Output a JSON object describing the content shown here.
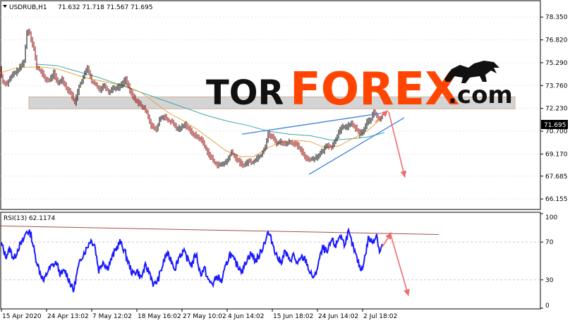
{
  "header": {
    "symbol": "USDRUB,H1",
    "ohlc": "71.632 71.718 71.567 71.695"
  },
  "logo": {
    "part1": "TOR",
    "part2": "FOREX",
    "part3": ".com"
  },
  "colors": {
    "price": "#000000",
    "bull": "#000000",
    "bear": "#8b0000",
    "ma_fast": "#e8a33a",
    "ma_slow": "#3aa8a8",
    "trendline": "#3d7fe0",
    "arrow": "#f06a6a",
    "zone": "#d0d0d0",
    "rsi": "#1a1aff",
    "rsi_resistance": "#a05050",
    "logo_dark": "#111111",
    "logo_orange": "#ff4500"
  },
  "chart_data": [
    {
      "type": "line",
      "title": "USDRUB,H1",
      "ylim": [
        65.5,
        79.4
      ],
      "yticks": [
        "78.350",
        "76.820",
        "75.290",
        "73.760",
        "72.230",
        "70.700",
        "69.170",
        "67.685",
        "66.155"
      ],
      "current_price": "71.695",
      "price_path": [
        [
          0,
          74.9
        ],
        [
          4,
          74.0
        ],
        [
          10,
          73.9
        ],
        [
          18,
          74.5
        ],
        [
          26,
          74.8
        ],
        [
          34,
          75.4
        ],
        [
          38,
          77.3
        ],
        [
          41,
          77.5
        ],
        [
          44,
          76.9
        ],
        [
          48,
          76.2
        ],
        [
          52,
          75.0
        ],
        [
          58,
          74.7
        ],
        [
          64,
          74.2
        ],
        [
          70,
          74.1
        ],
        [
          76,
          74.6
        ],
        [
          82,
          73.9
        ],
        [
          88,
          74.2
        ],
        [
          94,
          73.6
        ],
        [
          100,
          73.3
        ],
        [
          106,
          72.6
        ],
        [
          112,
          73.7
        ],
        [
          118,
          74.3
        ],
        [
          124,
          75.0
        ],
        [
          130,
          74.0
        ],
        [
          136,
          73.8
        ],
        [
          142,
          73.5
        ],
        [
          148,
          73.8
        ],
        [
          154,
          73.3
        ],
        [
          160,
          73.6
        ],
        [
          166,
          73.6
        ],
        [
          172,
          73.8
        ],
        [
          178,
          74.2
        ],
        [
          184,
          73.4
        ],
        [
          190,
          72.9
        ],
        [
          196,
          72.6
        ],
        [
          202,
          72.3
        ],
        [
          208,
          72.0
        ],
        [
          214,
          71.1
        ],
        [
          218,
          70.9
        ],
        [
          222,
          70.8
        ],
        [
          226,
          71.5
        ],
        [
          232,
          71.7
        ],
        [
          238,
          71.4
        ],
        [
          244,
          71.3
        ],
        [
          250,
          70.9
        ],
        [
          256,
          70.9
        ],
        [
          262,
          71.2
        ],
        [
          268,
          70.8
        ],
        [
          274,
          70.5
        ],
        [
          280,
          70.3
        ],
        [
          286,
          70.1
        ],
        [
          292,
          69.5
        ],
        [
          298,
          69.0
        ],
        [
          304,
          68.6
        ],
        [
          310,
          68.4
        ],
        [
          316,
          68.5
        ],
        [
          322,
          68.7
        ],
        [
          328,
          69.3
        ],
        [
          334,
          68.9
        ],
        [
          340,
          68.6
        ],
        [
          346,
          68.4
        ],
        [
          352,
          68.7
        ],
        [
          358,
          68.6
        ],
        [
          364,
          68.9
        ],
        [
          370,
          69.1
        ],
        [
          376,
          69.7
        ],
        [
          380,
          70.5
        ],
        [
          386,
          70.3
        ],
        [
          392,
          69.9
        ],
        [
          398,
          70.0
        ],
        [
          404,
          69.8
        ],
        [
          410,
          70.0
        ],
        [
          416,
          69.9
        ],
        [
          422,
          69.7
        ],
        [
          428,
          69.3
        ],
        [
          434,
          68.9
        ],
        [
          440,
          68.8
        ],
        [
          446,
          68.9
        ],
        [
          452,
          69.1
        ],
        [
          458,
          69.4
        ],
        [
          464,
          69.8
        ],
        [
          470,
          69.6
        ],
        [
          476,
          70.2
        ],
        [
          480,
          70.6
        ],
        [
          486,
          71.0
        ],
        [
          492,
          71.0
        ],
        [
          498,
          71.2
        ],
        [
          504,
          70.9
        ],
        [
          510,
          70.5
        ],
        [
          516,
          70.8
        ],
        [
          520,
          71.3
        ],
        [
          526,
          71.5
        ],
        [
          530,
          72.0
        ],
        [
          534,
          71.7
        ],
        [
          538,
          71.5
        ],
        [
          542,
          71.7
        ]
      ],
      "ma_fast": [
        [
          0,
          74.6
        ],
        [
          20,
          74.9
        ],
        [
          40,
          75.0
        ],
        [
          60,
          75.0
        ],
        [
          80,
          74.9
        ],
        [
          100,
          74.6
        ],
        [
          120,
          74.3
        ],
        [
          140,
          74.1
        ],
        [
          160,
          73.9
        ],
        [
          180,
          73.7
        ],
        [
          200,
          73.3
        ],
        [
          220,
          72.6
        ],
        [
          240,
          71.9
        ],
        [
          260,
          71.4
        ],
        [
          280,
          70.8
        ],
        [
          300,
          70.1
        ],
        [
          320,
          69.4
        ],
        [
          340,
          69.0
        ],
        [
          360,
          69.0
        ],
        [
          380,
          69.6
        ],
        [
          400,
          70.0
        ],
        [
          420,
          70.1
        ],
        [
          440,
          70.0
        ],
        [
          460,
          69.6
        ],
        [
          480,
          69.7
        ],
        [
          500,
          70.2
        ],
        [
          520,
          70.7
        ],
        [
          540,
          71.5
        ]
      ],
      "ma_slow": [
        [
          50,
          75.2
        ],
        [
          80,
          75.1
        ],
        [
          110,
          74.7
        ],
        [
          140,
          74.3
        ],
        [
          170,
          73.8
        ],
        [
          200,
          73.3
        ],
        [
          230,
          72.8
        ],
        [
          260,
          72.3
        ],
        [
          290,
          71.8
        ],
        [
          320,
          71.4
        ],
        [
          350,
          71.1
        ],
        [
          380,
          70.7
        ],
        [
          410,
          70.5
        ],
        [
          440,
          70.4
        ],
        [
          470,
          70.1
        ],
        [
          500,
          70.2
        ],
        [
          520,
          70.3
        ],
        [
          545,
          70.6
        ]
      ],
      "trendlines": [
        [
          [
            343,
            70.5
          ],
          [
            540,
            71.9
          ]
        ],
        [
          [
            438,
            67.8
          ],
          [
            573,
            71.6
          ]
        ]
      ],
      "arrows": [
        [
          [
            532,
            71.3
          ],
          [
            550,
            72.1
          ]
        ],
        [
          [
            551,
            72.0
          ],
          [
            574,
            67.6
          ]
        ]
      ],
      "zone": [
        72.2,
        73.0
      ]
    },
    {
      "type": "line",
      "title": "RSI(13) 62.1174",
      "ylim": [
        0,
        100
      ],
      "yticks": [
        "100",
        "70",
        "30",
        "0"
      ],
      "x_labels": [
        "15 Apr 2020",
        "24 Apr 13:02",
        "7 May 12:02",
        "18 May 16:02",
        "27 May 10:02",
        "4 Jun 14:02",
        "15 Jun 18:02",
        "24 Jun 14:02",
        "2 Jul 18:02"
      ],
      "rsi_path": [
        [
          0,
          68
        ],
        [
          6,
          55
        ],
        [
          12,
          62
        ],
        [
          18,
          52
        ],
        [
          24,
          64
        ],
        [
          30,
          70
        ],
        [
          36,
          82
        ],
        [
          42,
          78
        ],
        [
          48,
          55
        ],
        [
          54,
          40
        ],
        [
          60,
          28
        ],
        [
          66,
          40
        ],
        [
          72,
          45
        ],
        [
          78,
          48
        ],
        [
          84,
          35
        ],
        [
          90,
          40
        ],
        [
          96,
          30
        ],
        [
          102,
          18
        ],
        [
          108,
          40
        ],
        [
          114,
          55
        ],
        [
          120,
          62
        ],
        [
          126,
          72
        ],
        [
          132,
          68
        ],
        [
          138,
          40
        ],
        [
          144,
          50
        ],
        [
          150,
          42
        ],
        [
          156,
          52
        ],
        [
          162,
          62
        ],
        [
          168,
          70
        ],
        [
          174,
          62
        ],
        [
          180,
          48
        ],
        [
          186,
          36
        ],
        [
          192,
          40
        ],
        [
          198,
          32
        ],
        [
          204,
          44
        ],
        [
          210,
          38
        ],
        [
          216,
          24
        ],
        [
          222,
          30
        ],
        [
          228,
          44
        ],
        [
          234,
          58
        ],
        [
          240,
          52
        ],
        [
          246,
          42
        ],
        [
          252,
          55
        ],
        [
          258,
          60
        ],
        [
          264,
          52
        ],
        [
          270,
          46
        ],
        [
          276,
          58
        ],
        [
          282,
          36
        ],
        [
          288,
          42
        ],
        [
          294,
          28
        ],
        [
          300,
          26
        ],
        [
          306,
          34
        ],
        [
          312,
          28
        ],
        [
          318,
          44
        ],
        [
          324,
          58
        ],
        [
          330,
          50
        ],
        [
          336,
          44
        ],
        [
          342,
          40
        ],
        [
          348,
          52
        ],
        [
          354,
          58
        ],
        [
          360,
          50
        ],
        [
          366,
          56
        ],
        [
          372,
          68
        ],
        [
          378,
          80
        ],
        [
          384,
          70
        ],
        [
          390,
          56
        ],
        [
          396,
          48
        ],
        [
          402,
          60
        ],
        [
          408,
          50
        ],
        [
          414,
          56
        ],
        [
          420,
          46
        ],
        [
          426,
          54
        ],
        [
          432,
          50
        ],
        [
          438,
          36
        ],
        [
          444,
          32
        ],
        [
          450,
          50
        ],
        [
          456,
          64
        ],
        [
          462,
          58
        ],
        [
          468,
          72
        ],
        [
          474,
          66
        ],
        [
          480,
          78
        ],
        [
          486,
          68
        ],
        [
          492,
          80
        ],
        [
          498,
          66
        ],
        [
          504,
          52
        ],
        [
          510,
          40
        ],
        [
          516,
          56
        ],
        [
          520,
          74
        ],
        [
          526,
          70
        ],
        [
          532,
          78
        ],
        [
          536,
          60
        ],
        [
          540,
          66
        ]
      ],
      "resistance": [
        [
          0,
          87
        ],
        [
          622,
          78
        ]
      ],
      "arrows": [
        [
          [
            541,
            64
          ],
          [
            555,
            80
          ]
        ],
        [
          [
            553,
            80
          ],
          [
            579,
            13
          ]
        ]
      ]
    }
  ]
}
